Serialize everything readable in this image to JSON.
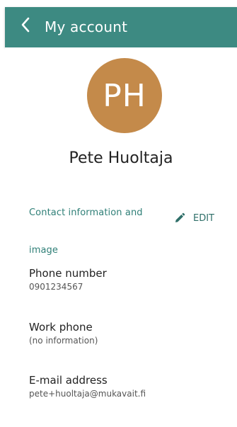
{
  "header": {
    "title": "My account"
  },
  "profile": {
    "initials": "PH",
    "name": "Pete Huoltaja",
    "avatar_color": "#c48a4a"
  },
  "contact_section": {
    "label": "Contact information and image",
    "edit_label": "EDIT"
  },
  "fields": [
    {
      "label": "Phone number",
      "value": "0901234567"
    },
    {
      "label": "Work phone",
      "value": "(no information)"
    },
    {
      "label": "E-mail address",
      "value": "pete+huoltaja@mukavait.fi"
    }
  ],
  "colors": {
    "appbar": "#3d8a82",
    "accent": "#2f7f77"
  }
}
